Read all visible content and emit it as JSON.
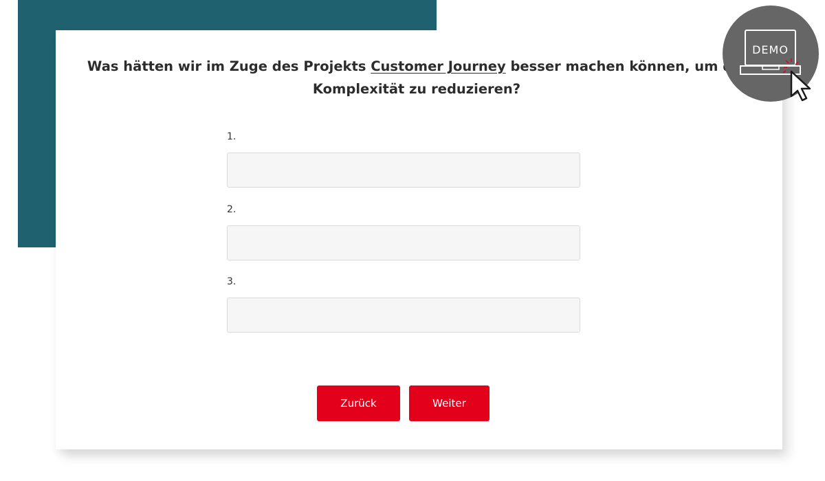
{
  "question": {
    "prefix": "Was hätten wir im Zuge des Projekts ",
    "link": "Customer Journey",
    "suffix": " besser machen können, um die Komplexität zu reduzieren?"
  },
  "fields": [
    {
      "label": "1.",
      "value": ""
    },
    {
      "label": "2.",
      "value": ""
    },
    {
      "label": "3.",
      "value": ""
    }
  ],
  "buttons": {
    "back_label": "Zurück",
    "next_label": "Weiter"
  },
  "demo_badge": {
    "label": "DEMO",
    "icon": "laptop-cursor-icon"
  },
  "colors": {
    "teal_accent": "#1f616e",
    "button_red": "#e2001a",
    "badge_gray": "#666666"
  }
}
